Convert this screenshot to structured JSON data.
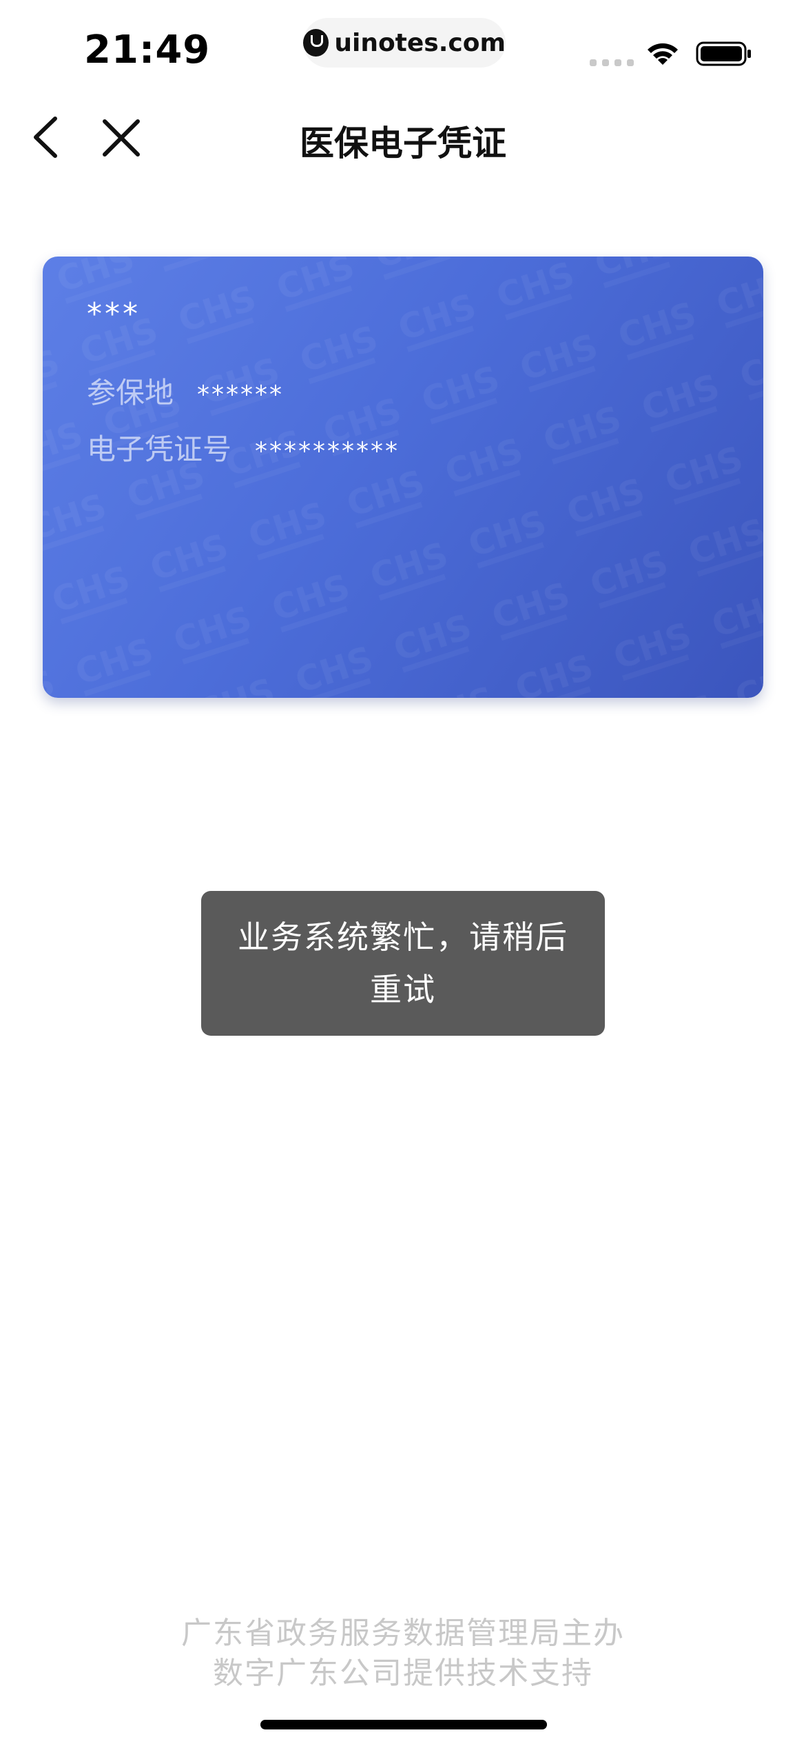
{
  "status_bar": {
    "time": "21:49",
    "url": "uinotes.com"
  },
  "nav": {
    "title": "医保电子凭证"
  },
  "card": {
    "name": "***",
    "rows": [
      {
        "label": "参保地",
        "value": "******"
      },
      {
        "label": "电子凭证号",
        "value": "**********"
      }
    ],
    "colors": {
      "start": "#5d7fe6",
      "end": "#3b55bd"
    }
  },
  "toast": {
    "line1": "业务系统繁忙，请稍后",
    "line2": "重试"
  },
  "footer": {
    "line1": "广东省政务服务数据管理局主办",
    "line2": "数字广东公司提供技术支持"
  },
  "icons": {
    "back": "chevron-left-icon",
    "close": "close-icon",
    "wifi": "wifi-icon",
    "battery": "battery-icon"
  }
}
